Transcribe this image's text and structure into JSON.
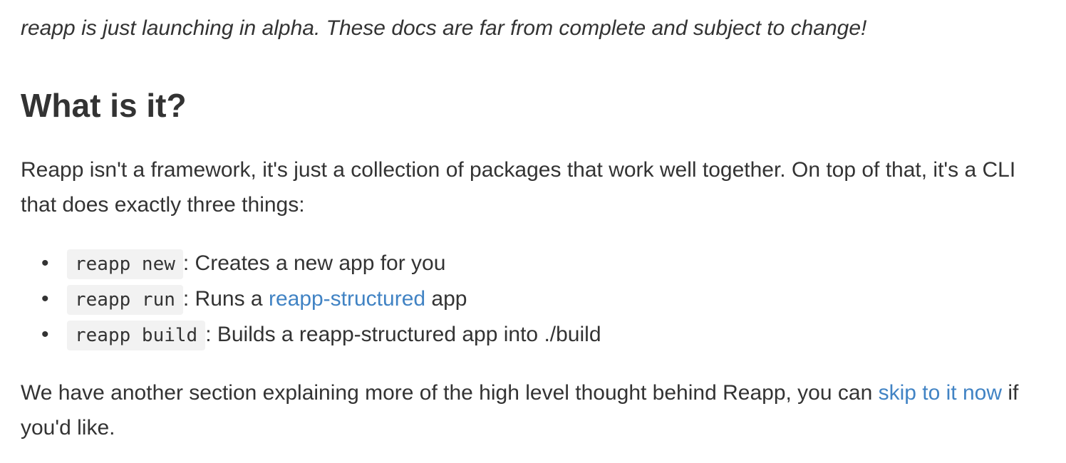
{
  "notice": {
    "text": "reapp is just launching in alpha. These docs are far from complete and subject to change!"
  },
  "heading": {
    "text": "What is it?"
  },
  "intro": {
    "text": "Reapp isn't a framework, it's just a collection of packages that work well together. On top of that, it's a CLI that does exactly three things:"
  },
  "commands": [
    {
      "code": "reapp new",
      "desc_before": ": Creates a new app for you",
      "link": "",
      "desc_after": ""
    },
    {
      "code": "reapp run",
      "desc_before": ": Runs a ",
      "link": "reapp-structured",
      "desc_after": " app"
    },
    {
      "code": "reapp build",
      "desc_before": ": Builds a reapp-structured app into ./build",
      "link": "",
      "desc_after": ""
    }
  ],
  "bullet_symbol": "•",
  "outro": {
    "text_before": "We have another section explaining more of the high level thought behind Reapp, you can ",
    "link": "skip to it now",
    "text_after": " if you'd like."
  },
  "colors": {
    "text": "#333333",
    "link": "#4183c4",
    "code_background": "#f2f2f2"
  }
}
